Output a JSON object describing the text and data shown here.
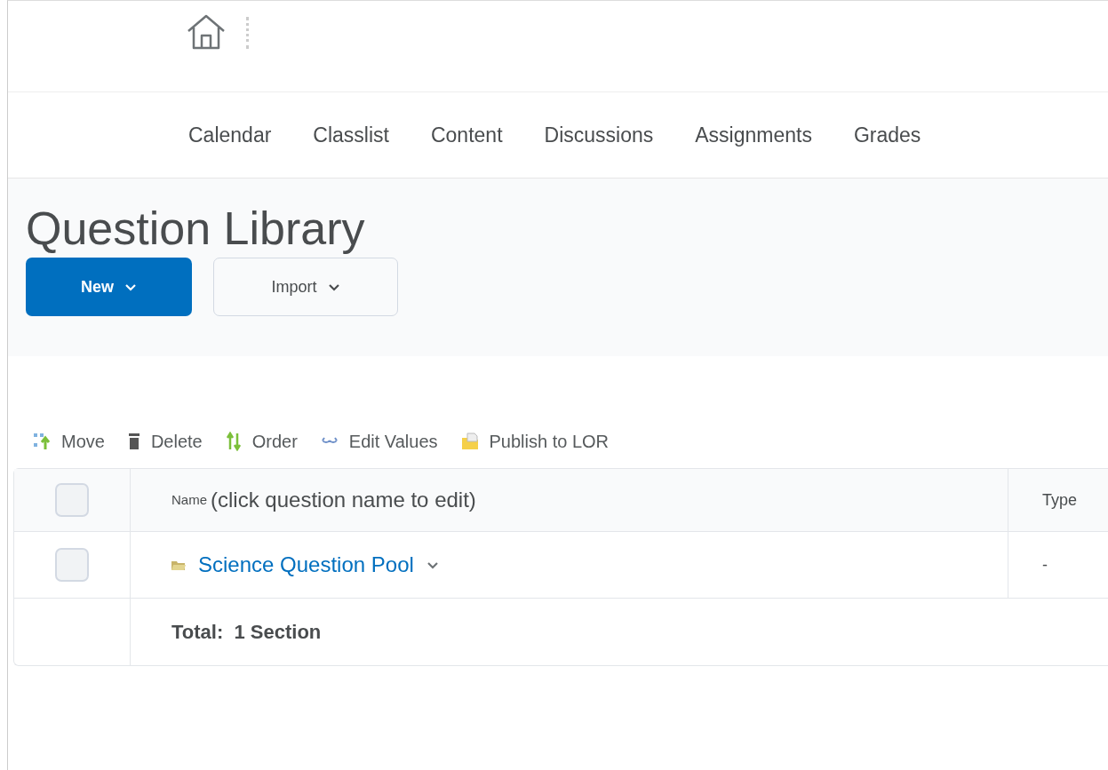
{
  "nav": {
    "items": [
      {
        "label": "Calendar"
      },
      {
        "label": "Classlist"
      },
      {
        "label": "Content"
      },
      {
        "label": "Discussions"
      },
      {
        "label": "Assignments"
      },
      {
        "label": "Grades"
      }
    ]
  },
  "page": {
    "title": "Question Library"
  },
  "buttons": [
    {
      "label": "New",
      "kind": "primary"
    },
    {
      "label": "Import",
      "kind": "secondary"
    }
  ],
  "toolbar": [
    {
      "label": "Move",
      "kind": "move"
    },
    {
      "label": "Delete",
      "kind": "delete"
    },
    {
      "label": "Order",
      "kind": "order"
    },
    {
      "label": "Edit Values",
      "kind": "values"
    },
    {
      "label": "Publish to LOR",
      "kind": "publish"
    }
  ],
  "table": {
    "header": {
      "checked": false,
      "name_label": "Name",
      "name_hint": "(click question name to edit)",
      "type": "Type"
    },
    "rows": [
      {
        "checked": false,
        "name": "Science Question Pool",
        "type": "-"
      }
    ],
    "footer": "Total:  1 Section"
  }
}
